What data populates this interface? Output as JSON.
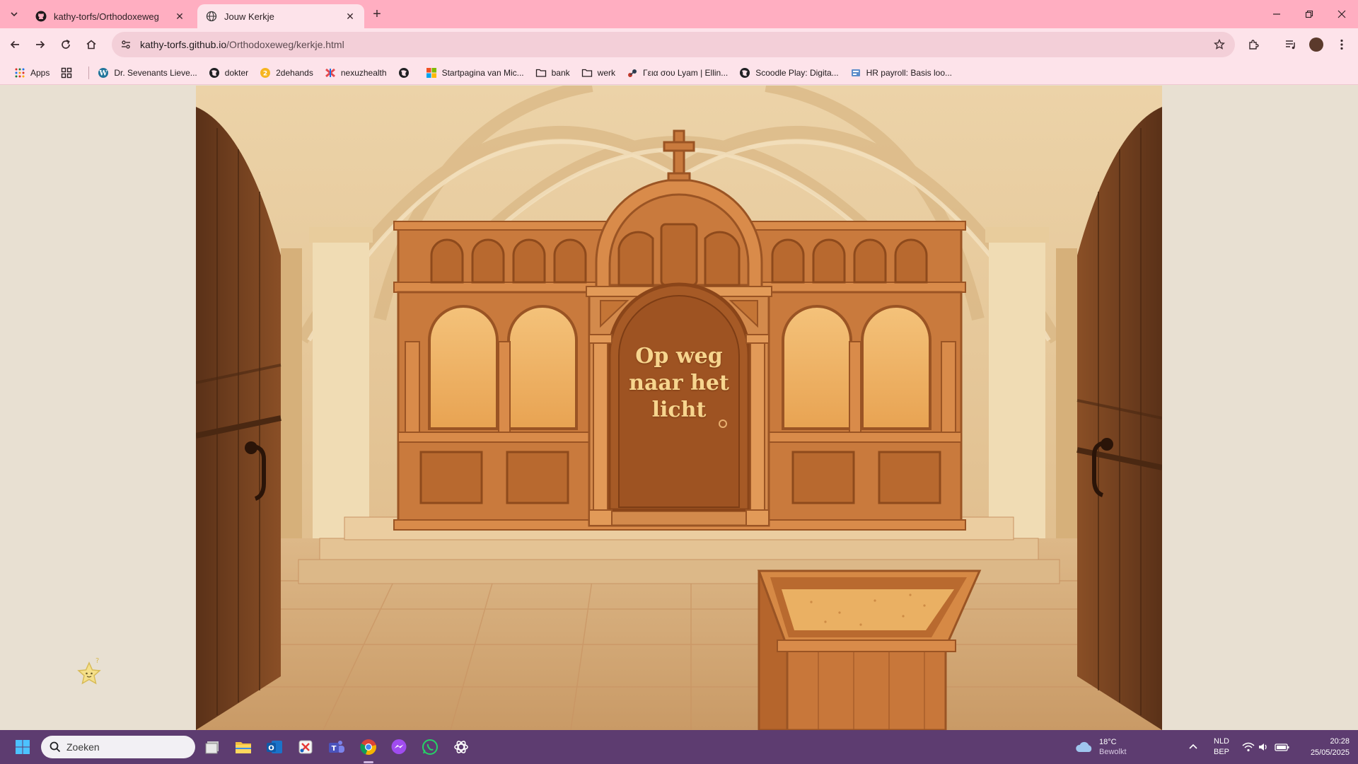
{
  "browser": {
    "tabs": [
      {
        "title": "kathy-torfs/Orthodoxeweg",
        "favicon": "github-icon",
        "active": false
      },
      {
        "title": "Jouw Kerkje",
        "favicon": "globe-icon",
        "active": true
      }
    ],
    "url_host": "kathy-torfs.github.io",
    "url_path": "/Orthodoxeweg/kerkje.html",
    "bookmarks": [
      {
        "label": "Apps",
        "icon": "apps-grid-icon"
      },
      {
        "label": "",
        "icon": "tab-groups-icon"
      },
      {
        "label": "Dr. Sevenants Lieve...",
        "icon": "wordpress-icon"
      },
      {
        "label": "dokter",
        "icon": "globe-icon"
      },
      {
        "label": "2dehands",
        "icon": "2dehands-icon"
      },
      {
        "label": "nexuzhealth",
        "icon": "nexuzhealth-icon"
      },
      {
        "label": "",
        "icon": "globe-icon"
      },
      {
        "label": "Startpagina van Mic...",
        "icon": "microsoft-icon"
      },
      {
        "label": "bank",
        "icon": "folder-icon"
      },
      {
        "label": "werk",
        "icon": "folder-icon"
      },
      {
        "label": "Γεια σου Lyam | Ellin...",
        "icon": "bookmark-site-icon"
      },
      {
        "label": "Scoodle Play: Digita...",
        "icon": "globe-icon"
      },
      {
        "label": "HR payroll: Basis loo...",
        "icon": "payroll-icon"
      }
    ]
  },
  "page": {
    "door_text_line1": "Op weg",
    "door_text_line2": "naar het",
    "door_text_line3": "licht"
  },
  "taskbar": {
    "search_placeholder": "Zoeken",
    "weather_temp": "18°C",
    "weather_desc": "Bewolkt",
    "lang_1": "NLD",
    "lang_2": "BEP",
    "time": "20:28",
    "date": "25/05/2025"
  }
}
